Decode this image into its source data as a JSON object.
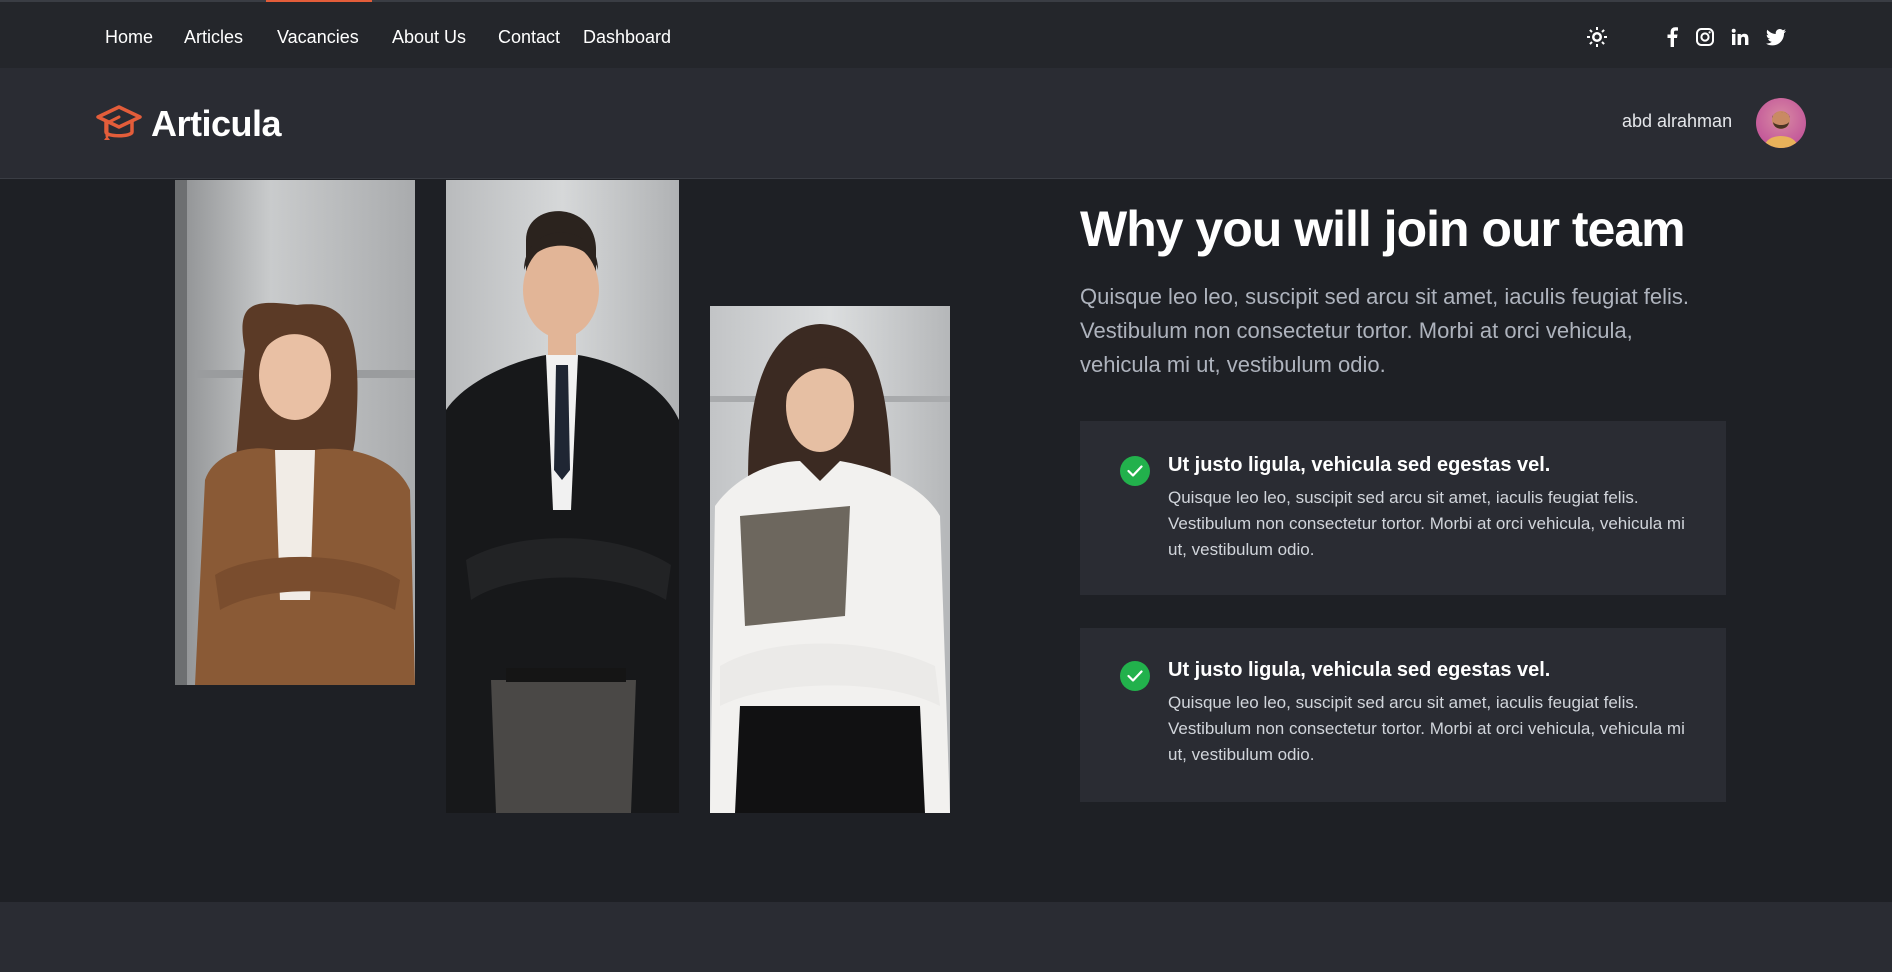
{
  "nav": {
    "items": [
      {
        "label": "Home"
      },
      {
        "label": "Articles"
      },
      {
        "label": "Vacancies"
      },
      {
        "label": "About Us"
      },
      {
        "label": "Contact"
      },
      {
        "label": "Dashboard"
      }
    ],
    "active": "Vacancies",
    "accent_color": "#e35d3a"
  },
  "top_icons": [
    "sun-icon",
    "facebook-icon",
    "instagram-icon",
    "linkedin-icon",
    "twitter-icon"
  ],
  "brand": {
    "name": "Articula",
    "icon": "graduation-cap-icon",
    "color": "#e35d3a"
  },
  "user": {
    "name": "abd alrahman",
    "avatar": "avatar"
  },
  "hero": {
    "title": "Why you will join our team",
    "intro": "Quisque leo leo, suscipit sed arcu sit amet, iaculis feugiat felis. Vestibulum non consectetur tortor. Morbi at orci vehicula, vehicula mi ut, vestibulum odio."
  },
  "features": [
    {
      "title": "Ut justo ligula, vehicula sed egestas vel.",
      "text": "Quisque leo leo, suscipit sed arcu sit amet, iaculis feugiat felis. Vestibulum non consectetur tortor. Morbi at orci vehicula, vehicula mi ut, vestibulum odio.",
      "icon": "check-circle-icon"
    },
    {
      "title": "Ut justo ligula, vehicula sed egestas vel.",
      "text": "Quisque leo leo, suscipit sed arcu sit amet, iaculis feugiat felis. Vestibulum non consectetur tortor. Morbi at orci vehicula, vehicula mi ut, vestibulum odio.",
      "icon": "check-circle-icon"
    }
  ],
  "colors": {
    "check": "#22b14c",
    "background": "#1e2025",
    "card": "#2a2c33"
  }
}
